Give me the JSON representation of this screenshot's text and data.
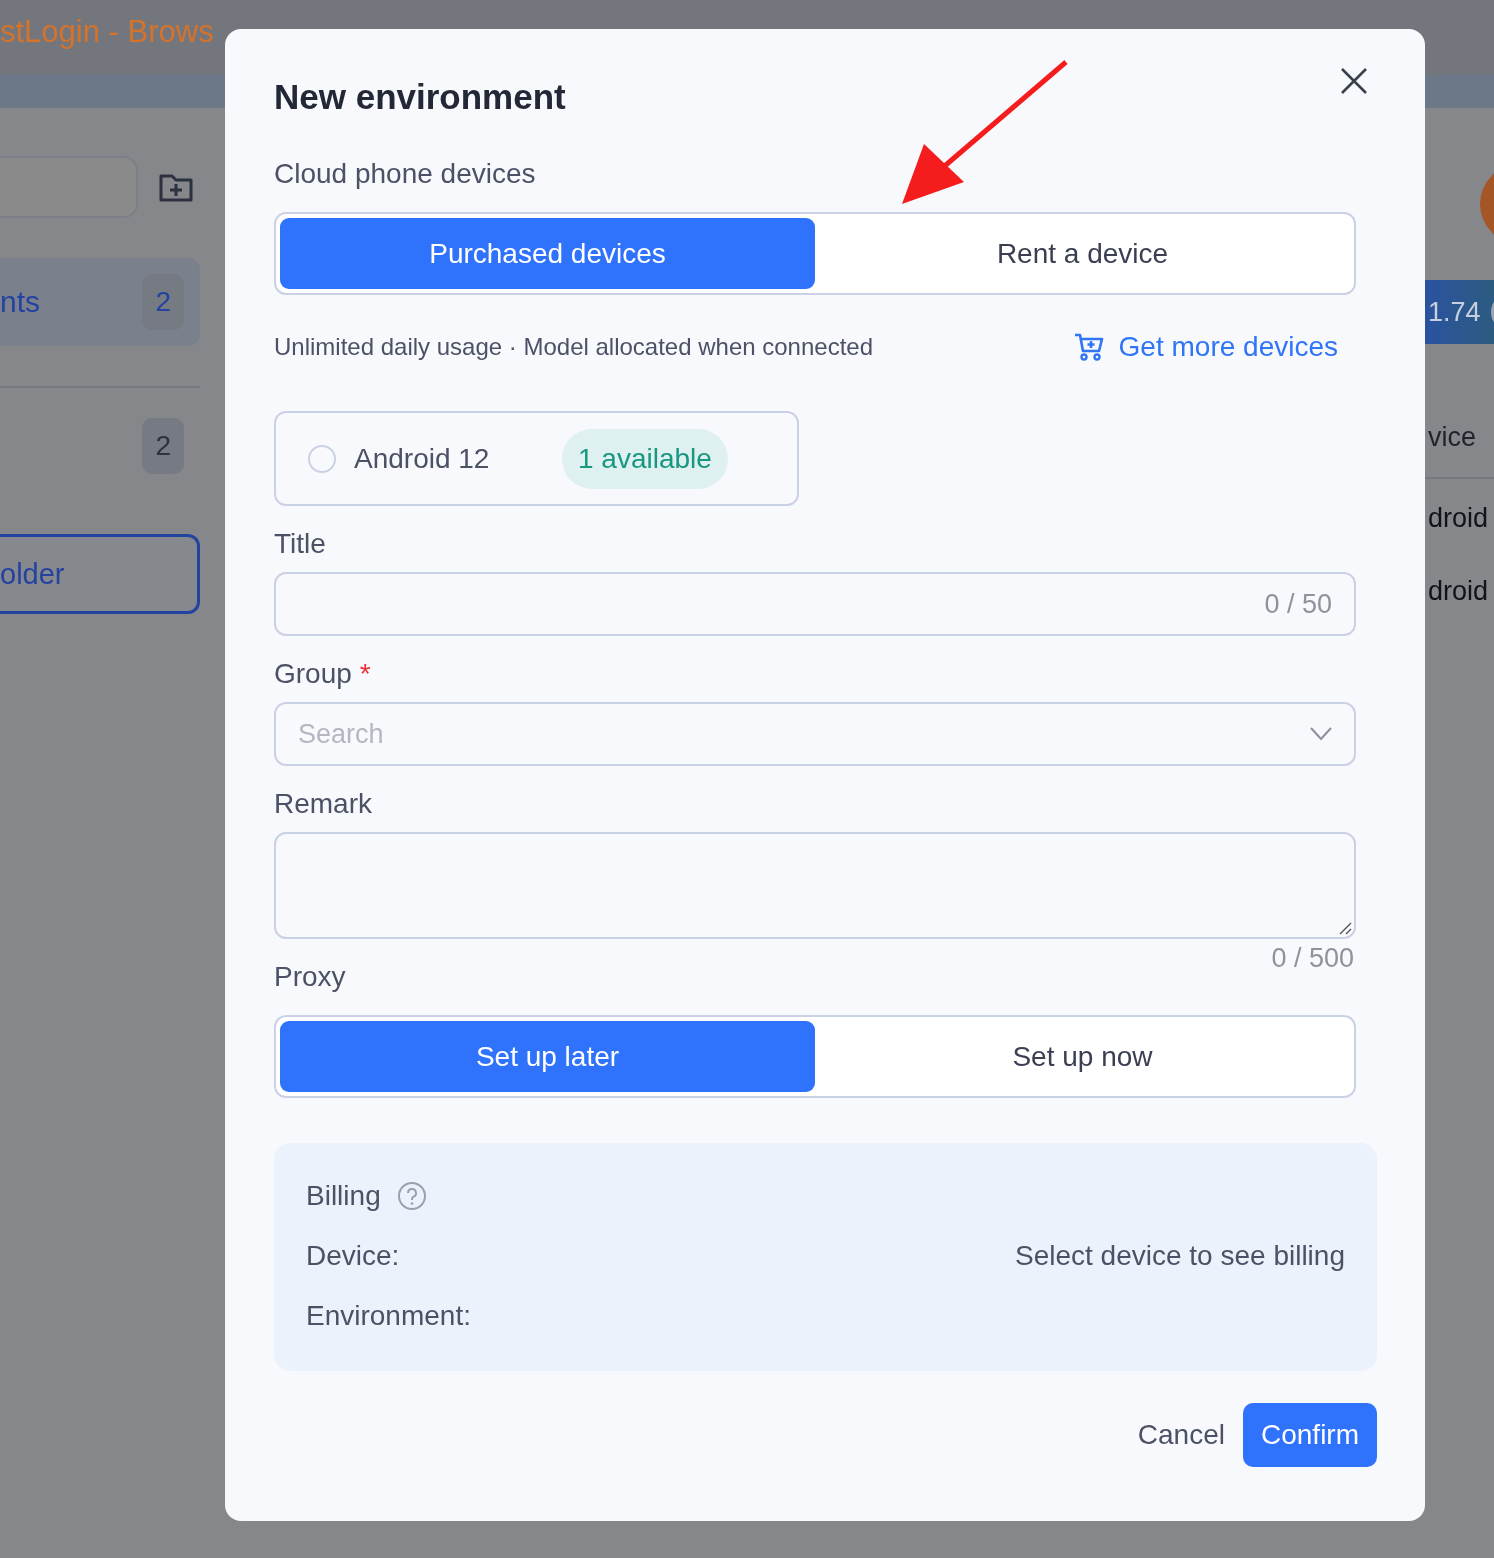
{
  "background": {
    "banner_text": "stLogin - Brows",
    "sidebar": {
      "items": [
        {
          "label": "nts",
          "count": "2",
          "selected": true
        },
        {
          "count": "2",
          "selected": false
        }
      ],
      "folder_button": "older"
    },
    "content": {
      "balance": "1.74",
      "column_header": "vice",
      "rows": [
        "droid",
        "droid"
      ]
    }
  },
  "modal": {
    "title": "New environment",
    "device_section": {
      "label": "Cloud phone devices",
      "tabs": [
        {
          "label": "Purchased devices",
          "selected": true
        },
        {
          "label": "Rent a device",
          "selected": false
        }
      ]
    },
    "info_text": "Unlimited daily usage · Model allocated when connected",
    "more_link": "Get more devices",
    "devices": [
      {
        "name": "Android 12",
        "badge": "1 available",
        "selected": false
      }
    ],
    "title_field": {
      "label": "Title",
      "counter": "0 / 50"
    },
    "group_field": {
      "label": "Group",
      "required_marker": "*",
      "placeholder": "Search"
    },
    "remark_field": {
      "label": "Remark",
      "counter": "0 / 500"
    },
    "proxy": {
      "label": "Proxy",
      "tabs": [
        {
          "label": "Set up later",
          "selected": true
        },
        {
          "label": "Set up now",
          "selected": false
        }
      ]
    },
    "billing": {
      "title": "Billing",
      "rows": [
        {
          "label": "Device:",
          "value": "Select device to see billing"
        },
        {
          "label": "Environment:"
        }
      ]
    },
    "buttons": {
      "cancel": "Cancel",
      "confirm": "Confirm"
    }
  }
}
